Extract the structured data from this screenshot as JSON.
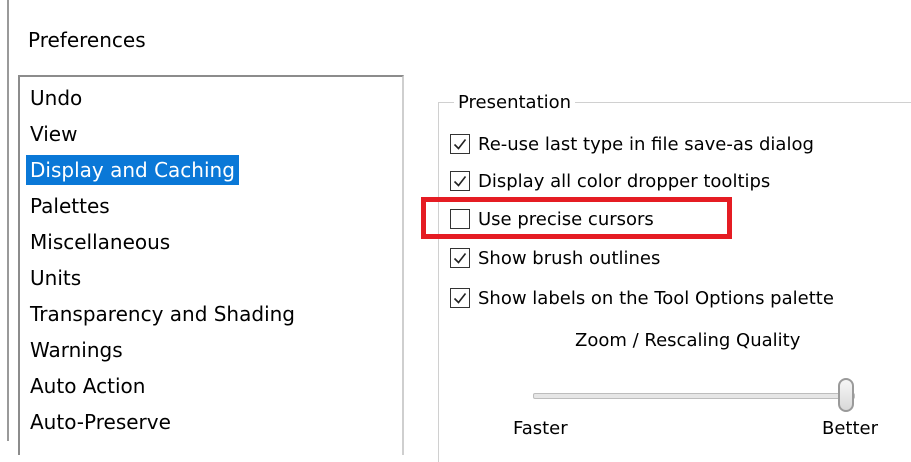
{
  "dialog": {
    "title": "Preferences"
  },
  "categories": [
    {
      "label": "Undo"
    },
    {
      "label": "View"
    },
    {
      "label": "Display and Caching",
      "selected": true
    },
    {
      "label": "Palettes"
    },
    {
      "label": "Miscellaneous"
    },
    {
      "label": "Units"
    },
    {
      "label": "Transparency and Shading"
    },
    {
      "label": "Warnings"
    },
    {
      "label": "Auto Action"
    },
    {
      "label": "Auto-Preserve"
    }
  ],
  "presentation": {
    "legend": "Presentation",
    "options": [
      {
        "label": "Re-use last type in file save-as dialog",
        "checked": true
      },
      {
        "label": "Display all color dropper tooltips",
        "checked": true
      },
      {
        "label": "Use precise cursors",
        "checked": false
      },
      {
        "label": "Show brush outlines",
        "checked": true
      },
      {
        "label": "Show labels on the Tool Options palette",
        "checked": true
      }
    ]
  },
  "zoom": {
    "label": "Zoom / Rescaling Quality",
    "min_label": "Faster",
    "max_label": "Better",
    "value_fraction": 1.0
  },
  "colors": {
    "selection": "#0a78d7",
    "highlight": "#e51c23"
  }
}
